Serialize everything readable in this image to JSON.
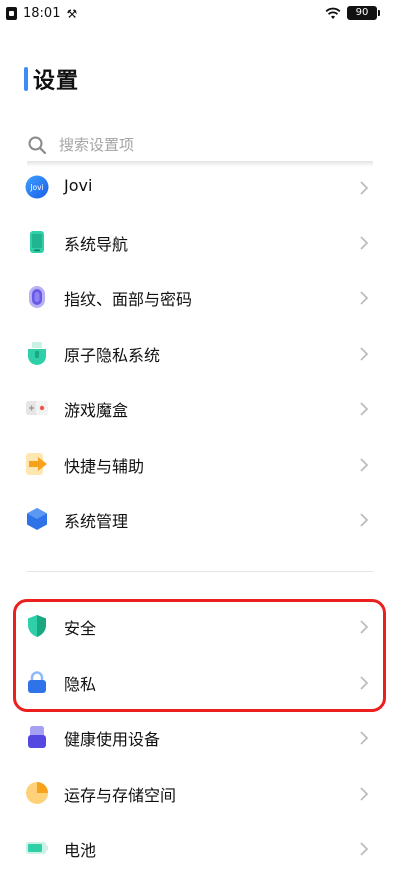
{
  "status_bar": {
    "time": "18:01",
    "tools_glyph": "⚒",
    "battery": "90"
  },
  "header": {
    "title": "设置"
  },
  "search": {
    "placeholder": "搜索设置项"
  },
  "items": [
    {
      "label": "Jovi",
      "icon": "jovi-icon"
    },
    {
      "label": "系统导航",
      "icon": "phone-navigation-icon"
    },
    {
      "label": "指纹、面部与密码",
      "icon": "fingerprint-icon"
    },
    {
      "label": "原子隐私系统",
      "icon": "atomic-privacy-icon"
    },
    {
      "label": "游戏魔盒",
      "icon": "game-box-icon"
    },
    {
      "label": "快捷与辅助",
      "icon": "shortcut-arrow-icon"
    },
    {
      "label": "系统管理",
      "icon": "system-management-icon"
    },
    {
      "label": "安全",
      "icon": "shield-icon"
    },
    {
      "label": "隐私",
      "icon": "lock-icon"
    },
    {
      "label": "健康使用设备",
      "icon": "healthy-usage-icon"
    },
    {
      "label": "运存与存储空间",
      "icon": "storage-pie-icon"
    },
    {
      "label": "电池",
      "icon": "battery-icon"
    }
  ],
  "jovi_icon_text": "Jovi",
  "colors": {
    "accent": "#3d8df5",
    "highlight": "#ec1f1f"
  }
}
